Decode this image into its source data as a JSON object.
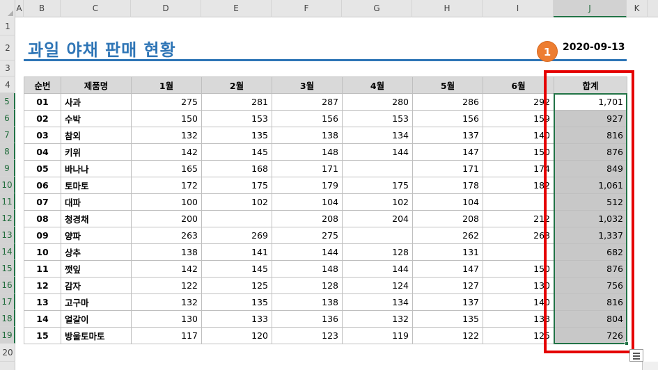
{
  "spreadsheet": {
    "columns": [
      "A",
      "B",
      "C",
      "D",
      "E",
      "F",
      "G",
      "H",
      "I",
      "J",
      "K"
    ],
    "selected_column": "J",
    "rows": [
      "1",
      "2",
      "3",
      "4",
      "5",
      "6",
      "7",
      "8",
      "9",
      "10",
      "11",
      "12",
      "13",
      "14",
      "15",
      "16",
      "17",
      "18",
      "19",
      "20"
    ],
    "title": "과일 야채 판매 현황",
    "date": "2020-09-13",
    "badge": "1",
    "accent_color": "#2e75b6",
    "selection_color": "#217346",
    "highlight_color": "#e50000",
    "badge_color": "#ed7d31",
    "icons": [
      "paste-options-icon"
    ],
    "table": {
      "headers": [
        "순번",
        "제품명",
        "1월",
        "2월",
        "3월",
        "4월",
        "5월",
        "6월",
        "합계"
      ],
      "rows": [
        [
          "01",
          "사과",
          "275",
          "281",
          "287",
          "280",
          "286",
          "292",
          "1,701"
        ],
        [
          "02",
          "수박",
          "150",
          "153",
          "156",
          "153",
          "156",
          "159",
          "927"
        ],
        [
          "03",
          "참외",
          "132",
          "135",
          "138",
          "134",
          "137",
          "140",
          "816"
        ],
        [
          "04",
          "키위",
          "142",
          "145",
          "148",
          "144",
          "147",
          "150",
          "876"
        ],
        [
          "05",
          "바나나",
          "165",
          "168",
          "171",
          "",
          "171",
          "174",
          "849"
        ],
        [
          "06",
          "토마토",
          "172",
          "175",
          "179",
          "175",
          "178",
          "182",
          "1,061"
        ],
        [
          "07",
          "대파",
          "100",
          "102",
          "104",
          "102",
          "104",
          "",
          "512"
        ],
        [
          "08",
          "청경채",
          "200",
          "",
          "208",
          "204",
          "208",
          "212",
          "1,032"
        ],
        [
          "09",
          "양파",
          "263",
          "269",
          "275",
          "",
          "262",
          "268",
          "1,337"
        ],
        [
          "10",
          "상추",
          "138",
          "141",
          "144",
          "128",
          "131",
          "",
          "682"
        ],
        [
          "11",
          "깻잎",
          "142",
          "145",
          "148",
          "144",
          "147",
          "150",
          "876"
        ],
        [
          "12",
          "감자",
          "122",
          "125",
          "128",
          "124",
          "127",
          "130",
          "756"
        ],
        [
          "13",
          "고구마",
          "132",
          "135",
          "138",
          "134",
          "137",
          "140",
          "816"
        ],
        [
          "14",
          "얼갈이",
          "130",
          "133",
          "136",
          "132",
          "135",
          "138",
          "804"
        ],
        [
          "15",
          "방울토마토",
          "117",
          "120",
          "123",
          "119",
          "122",
          "125",
          "726"
        ]
      ]
    }
  }
}
